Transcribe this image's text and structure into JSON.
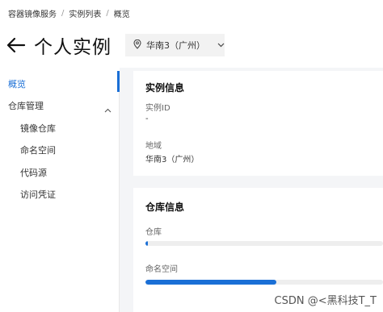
{
  "breadcrumb": {
    "items": [
      "容器镜像服务",
      "实例列表",
      "概览"
    ],
    "separator": "/"
  },
  "header": {
    "title": "个人实例",
    "back_icon": "arrow-left-icon",
    "region": "华南3（广州）",
    "region_icon": "location-pin-icon"
  },
  "sidebar": {
    "items": [
      {
        "label": "概览",
        "active": true
      },
      {
        "label": "仓库管理",
        "expanded": true
      },
      {
        "label": "镜像仓库"
      },
      {
        "label": "命名空间"
      },
      {
        "label": "代码源"
      },
      {
        "label": "访问凭证"
      }
    ]
  },
  "instance_card": {
    "title": "实例信息",
    "id_label": "实例ID",
    "id_value": "-",
    "region_label": "地域",
    "region_value": "华南3（广州）"
  },
  "repo_card": {
    "title": "仓库信息",
    "repo_label": "仓库",
    "repo_usage_fraction": 0.01,
    "namespace_label": "命名空间",
    "namespace_usage_fraction": 0.55
  },
  "colors": {
    "accent": "#1a6fd6",
    "content_bg": "#f4f5f7"
  },
  "watermark": "CSDN @<黑科技T_T"
}
